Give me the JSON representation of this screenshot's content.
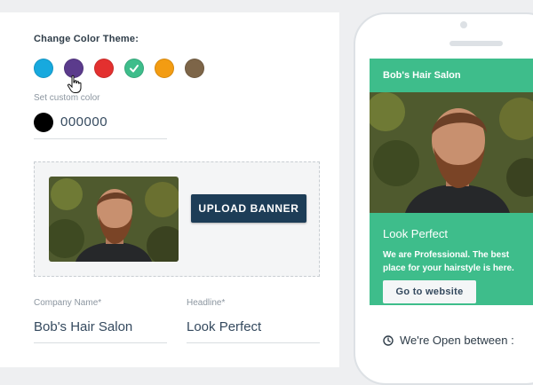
{
  "editor": {
    "theme_title": "Change Color Theme:",
    "swatches": [
      {
        "name": "blue",
        "color": "#17a9de",
        "selected": false
      },
      {
        "name": "purple",
        "color": "#5b3b8c",
        "selected": false
      },
      {
        "name": "red",
        "color": "#e3302f",
        "selected": false
      },
      {
        "name": "green",
        "color": "#3ebd8b",
        "selected": true
      },
      {
        "name": "orange",
        "color": "#f39c12",
        "selected": false
      },
      {
        "name": "brown",
        "color": "#7d6548",
        "selected": false
      }
    ],
    "custom_color_label": "Set custom color",
    "custom_color_value": "000000",
    "upload_banner_label": "UPLOAD BANNER",
    "company_name_label": "Company Name*",
    "company_name_value": "Bob's Hair Salon",
    "headline_label": "Headline*",
    "headline_value": "Look Perfect"
  },
  "preview": {
    "header_title": "Bob's Hair Salon",
    "headline": "Look Perfect",
    "description": "We are Professional. The best place for your hairstyle is here.",
    "cta_label": "Go to website",
    "open_label": "We're Open between :"
  },
  "colors": {
    "accent": "#3ebd8b",
    "button_dark": "#1d3d57",
    "text_dark": "#34495e"
  },
  "icons": [
    "check-icon",
    "pointer-cursor-icon",
    "clock-icon"
  ]
}
